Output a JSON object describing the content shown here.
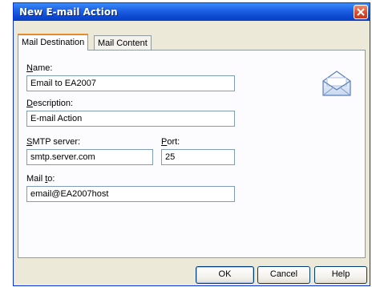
{
  "window": {
    "title": "New E-mail Action"
  },
  "tabs": [
    {
      "label": "Mail Destination",
      "selected": true
    },
    {
      "label": "Mail Content",
      "selected": false
    }
  ],
  "form": {
    "name": {
      "label_prefix": "",
      "label_mnemonic": "N",
      "label_rest": "ame:",
      "value": "Email to EA2007"
    },
    "description": {
      "label_prefix": "",
      "label_mnemonic": "D",
      "label_rest": "escription:",
      "value": "E-mail Action"
    },
    "smtp_server": {
      "label_prefix": "",
      "label_mnemonic": "S",
      "label_rest": "MTP server:",
      "value": "smtp.server.com"
    },
    "port": {
      "label_prefix": "",
      "label_mnemonic": "P",
      "label_rest": "ort:",
      "value": "25"
    },
    "mail_to": {
      "label_prefix": "Mail ",
      "label_mnemonic": "t",
      "label_rest": "o:",
      "value": "email@EA2007host"
    }
  },
  "buttons": {
    "ok": "OK",
    "cancel": "Cancel",
    "help": "Help"
  },
  "icons": {
    "close": "close-icon",
    "envelope": "envelope-icon"
  }
}
